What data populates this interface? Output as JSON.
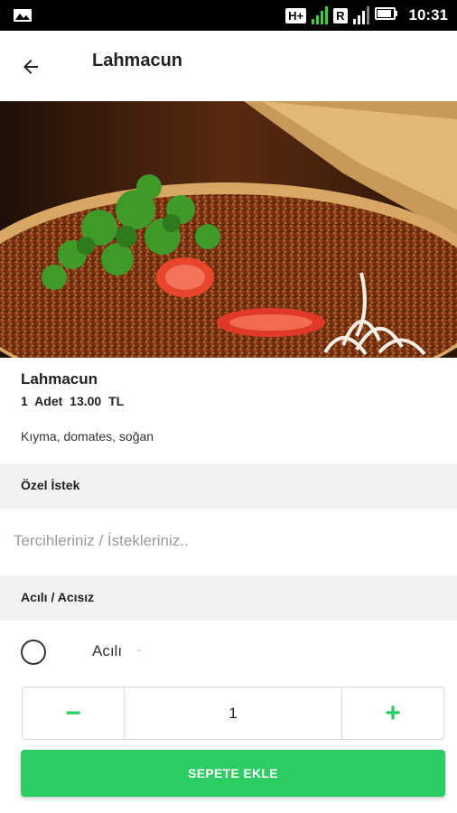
{
  "status_bar": {
    "network_badge_1": "H+",
    "network_badge_2": "R",
    "time": "10:31",
    "icons": [
      "gallery-icon",
      "signal-icon",
      "battery-icon"
    ]
  },
  "app_bar": {
    "title": "Lahmacun",
    "back_icon": "arrow-back-icon"
  },
  "product": {
    "name": "Lahmacun",
    "price": "1 Adet 13.00 TL",
    "description": "Kıyma, domates, soğan"
  },
  "special_request": {
    "header": "Özel İstek",
    "placeholder": "Tercihleriniz / İstekleriniz.."
  },
  "spice_option": {
    "header": "Acılı / Acısız",
    "option_label": "Acılı",
    "option_extra": "-"
  },
  "quantity": {
    "minus": "−",
    "value": "1",
    "plus": "+"
  },
  "add_to_cart_label": "SEPETE EKLE",
  "colors": {
    "accent": "#2ecc64",
    "section_bg": "#f2f2f2"
  }
}
